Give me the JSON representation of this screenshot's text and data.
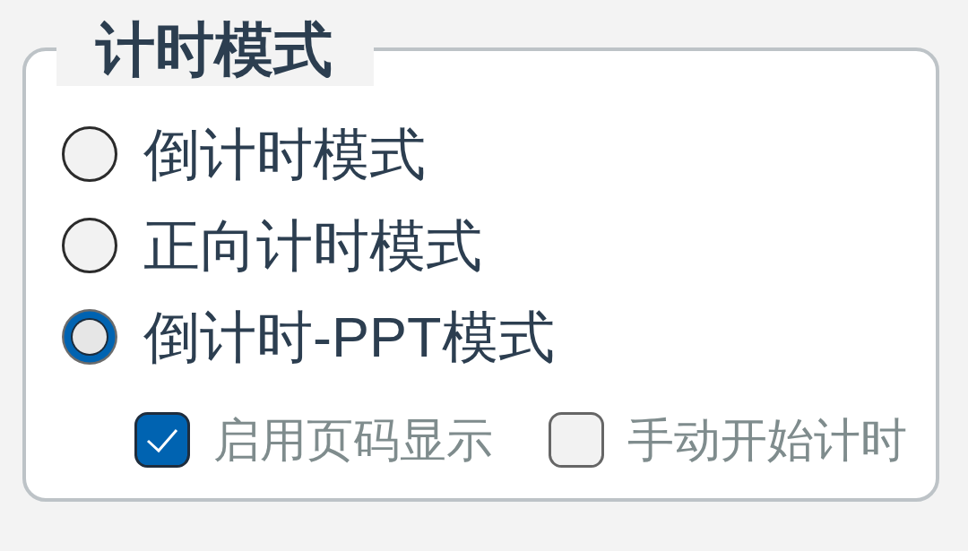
{
  "group": {
    "title": "计时模式"
  },
  "radios": [
    {
      "label": "倒计时模式",
      "selected": false
    },
    {
      "label": "正向计时模式",
      "selected": false
    },
    {
      "label": "倒计时-PPT模式",
      "selected": true
    }
  ],
  "checkboxes": [
    {
      "label": "启用页码显示",
      "checked": true
    },
    {
      "label": "手动开始计时",
      "checked": false
    }
  ]
}
